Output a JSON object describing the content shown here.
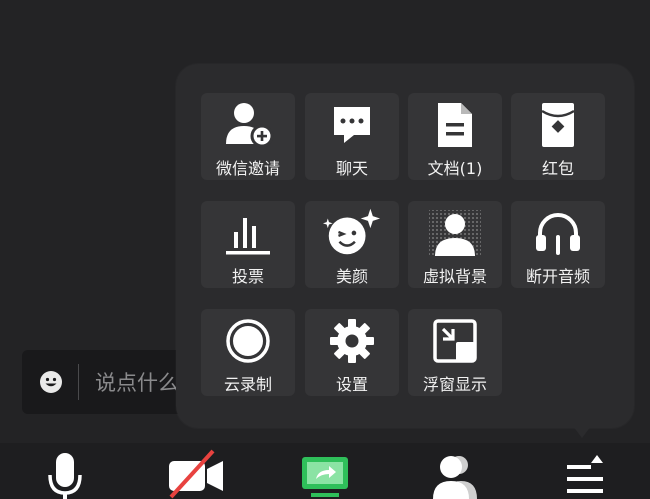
{
  "chat": {
    "placeholder": "说点什么"
  },
  "menu": {
    "items": [
      {
        "label": "微信邀请",
        "icon": "invite-user-icon"
      },
      {
        "label": "聊天",
        "icon": "chat-bubble-icon"
      },
      {
        "label": "文档(1)",
        "icon": "document-icon"
      },
      {
        "label": "红包",
        "icon": "red-packet-icon"
      },
      {
        "label": "投票",
        "icon": "vote-bars-icon"
      },
      {
        "label": "美颜",
        "icon": "beauty-face-icon"
      },
      {
        "label": "虚拟背景",
        "icon": "virtual-background-icon"
      },
      {
        "label": "断开音频",
        "icon": "headphones-icon"
      },
      {
        "label": "云录制",
        "icon": "cloud-record-icon"
      },
      {
        "label": "设置",
        "icon": "gear-icon"
      },
      {
        "label": "浮窗显示",
        "icon": "floating-window-icon"
      }
    ]
  },
  "toolbar": {
    "buttons": [
      {
        "icon": "microphone-icon"
      },
      {
        "icon": "camera-off-icon"
      },
      {
        "icon": "screen-share-icon",
        "active_color": "#2fbf5a"
      },
      {
        "icon": "participants-icon"
      },
      {
        "icon": "more-menu-icon"
      }
    ]
  },
  "colors": {
    "background": "#232325",
    "panel": "#2b2b2d",
    "tile": "#353537",
    "accent_green": "#2fbf5a"
  }
}
